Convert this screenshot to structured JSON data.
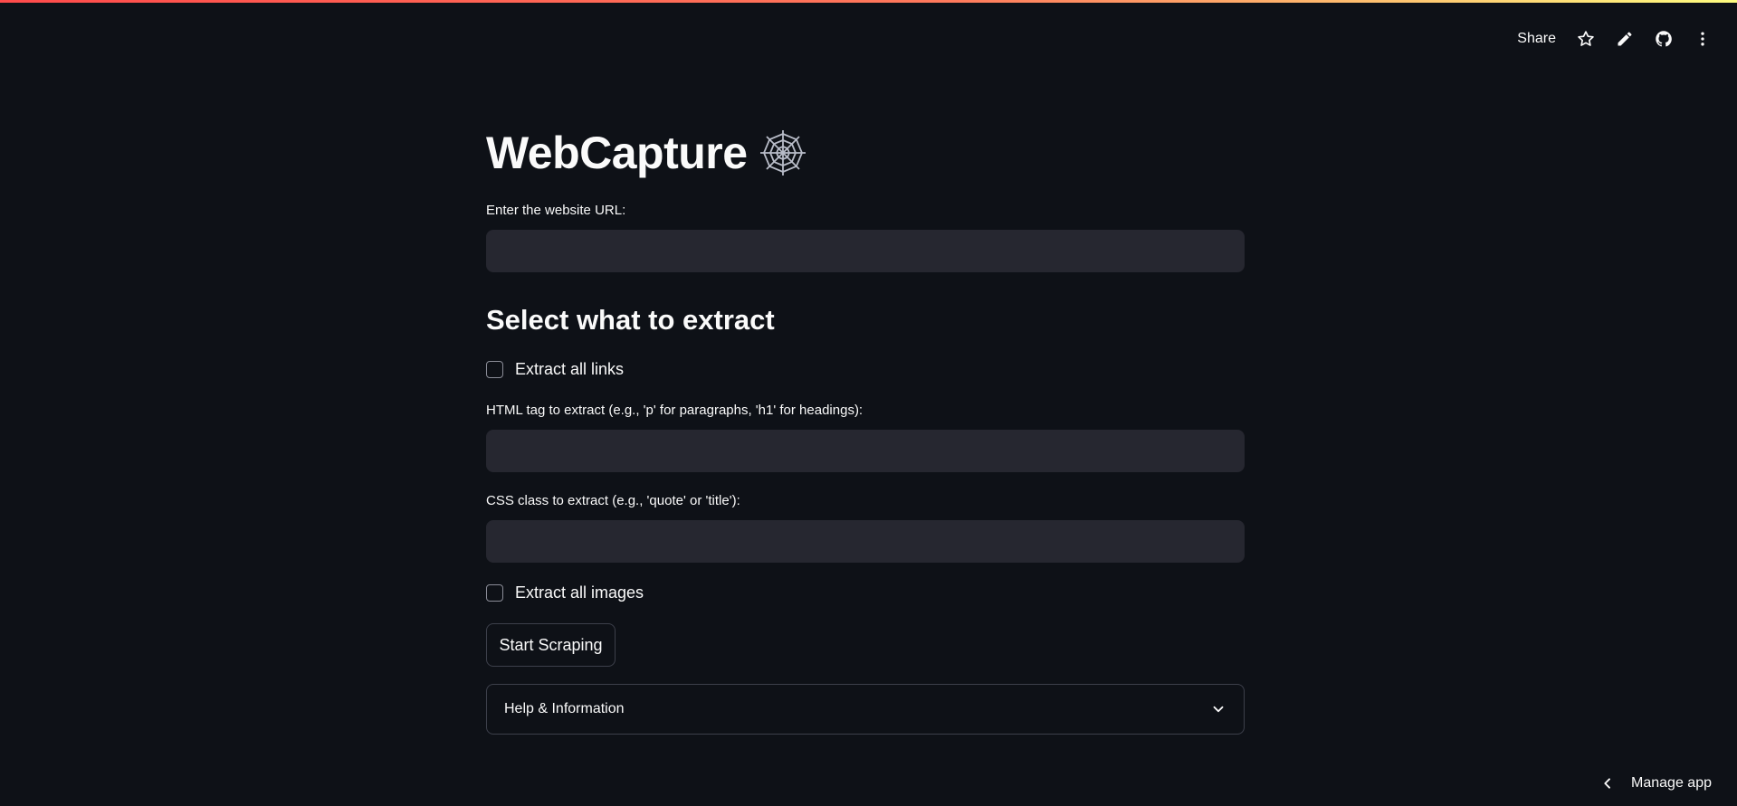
{
  "header": {
    "share_label": "Share",
    "icons": [
      "star-icon",
      "pencil-icon",
      "github-icon",
      "more-vertical-icon"
    ]
  },
  "colors": {
    "background": "#0e1117",
    "input_background": "#262730",
    "text": "#fafafa",
    "border": "#3d404b",
    "decoration_start": "#ff4b4b",
    "decoration_end": "#fffd80"
  },
  "main": {
    "title": "WebCapture",
    "title_icon": "spider-web-icon",
    "url_label": "Enter the website URL:",
    "url_value": "",
    "subheader": "Select what to extract",
    "links_checkbox_label": "Extract all links",
    "links_checked": false,
    "tag_label": "HTML tag to extract (e.g., 'p' for paragraphs, 'h1' for headings):",
    "tag_value": "",
    "class_label": "CSS class to extract (e.g., 'quote' or 'title'):",
    "class_value": "",
    "images_checkbox_label": "Extract all images",
    "images_checked": false,
    "button_label": "Start Scraping",
    "expander_label": "Help & Information"
  },
  "footer": {
    "manage_label": "Manage app"
  }
}
